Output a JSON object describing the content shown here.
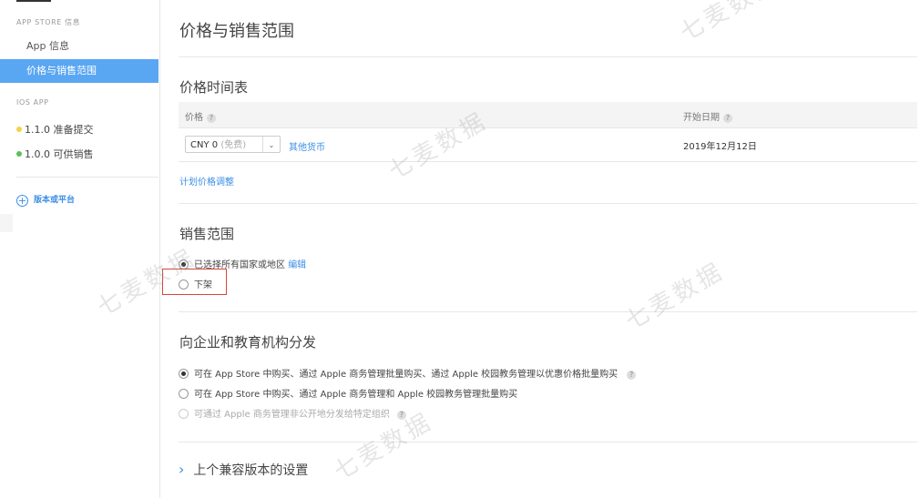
{
  "sidebar": {
    "section1": "APP STORE 信息",
    "items": [
      {
        "label": "App 信息"
      },
      {
        "label": "价格与销售范围"
      }
    ],
    "section2": "IOS APP",
    "versions": [
      {
        "label": "1.1.0 准备提交",
        "color": "#f2d24a"
      },
      {
        "label": "1.0.0 可供销售",
        "color": "#5cc05c"
      }
    ],
    "add_platform": "版本或平台",
    "add_icon": "+"
  },
  "main": {
    "page_title": "价格与销售范围",
    "price_schedule": {
      "title": "价格时间表",
      "col_price": "价格",
      "col_start": "开始日期",
      "help": "?",
      "select_value": "CNY 0",
      "select_hint": "(免费)",
      "select_caret": "⌄",
      "other_currency": "其他货币",
      "start_date": "2019年12月12日",
      "plan_adjust": "计划价格调整"
    },
    "sales_range": {
      "title": "销售范围",
      "option1": "已选择所有国家或地区",
      "edit": "编辑",
      "option2": "下架"
    },
    "enterprise": {
      "title": "向企业和教育机构分发",
      "option1": "可在 App Store 中购买、通过 Apple 商务管理批量购买、通过 Apple 校园教务管理以优惠价格批量购买",
      "option2": "可在 App Store 中购买、通过 Apple 商务管理和 Apple 校园教务管理批量购买",
      "option3": "可通过 Apple 商务管理非公开地分发给特定组织"
    },
    "previous_versions": {
      "chevron": "›",
      "title": "上个兼容版本的设置"
    }
  },
  "watermark": "七麦数据",
  "colors": {
    "accent": "#59a6f3",
    "link": "#3b8ee6",
    "highlight_box": "#d9443b"
  }
}
